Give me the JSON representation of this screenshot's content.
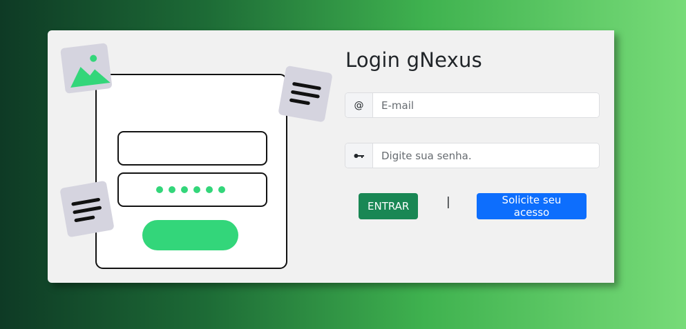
{
  "login": {
    "title": "Login gNexus",
    "email": {
      "icon": "@",
      "placeholder": "E-mail",
      "value": ""
    },
    "password": {
      "icon": "key-icon",
      "placeholder": "Digite sua senha.",
      "value": ""
    },
    "enter_label": "ENTRAR",
    "separator": "|",
    "request_label": "Solicite seu acesso"
  },
  "colors": {
    "brand_green": "#198754",
    "request_blue": "#0d6efd",
    "illustration_accent": "#33d67a",
    "card_bg": "#f1f1f1"
  }
}
